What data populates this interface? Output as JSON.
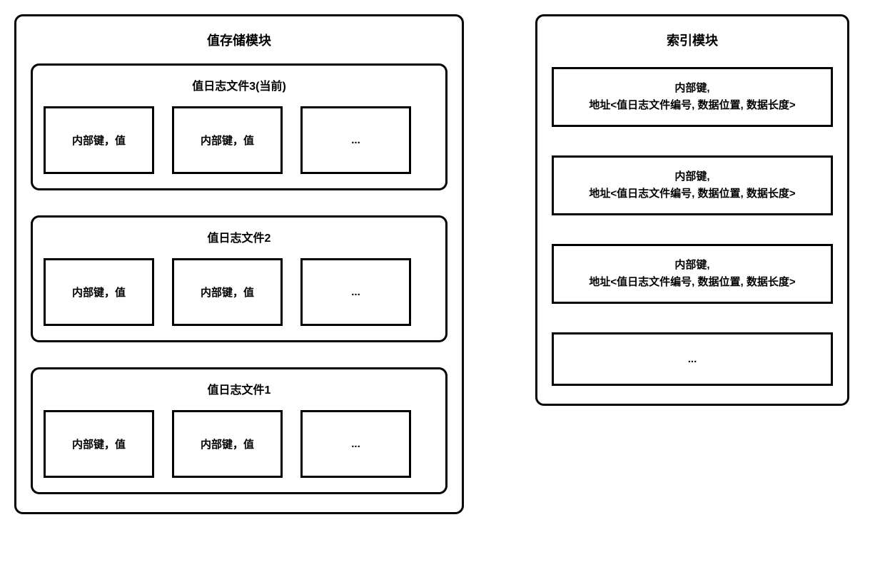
{
  "storage": {
    "title": "值存储模块",
    "files": [
      {
        "title": "值日志文件3(当前)",
        "entries": [
          "内部键，值",
          "内部键，值",
          "..."
        ]
      },
      {
        "title": "值日志文件2",
        "entries": [
          "内部键，值",
          "内部键，值",
          "..."
        ]
      },
      {
        "title": "值日志文件1",
        "entries": [
          "内部键，值",
          "内部键，值",
          "..."
        ]
      }
    ]
  },
  "index": {
    "title": "索引模块",
    "entries": [
      {
        "line1": "内部键,",
        "line2": "地址<值日志文件编号, 数据位置, 数据长度>"
      },
      {
        "line1": "内部键,",
        "line2": "地址<值日志文件编号, 数据位置, 数据长度>"
      },
      {
        "line1": "内部键,",
        "line2": "地址<值日志文件编号, 数据位置, 数据长度>"
      },
      {
        "ellipsis": "..."
      }
    ]
  }
}
